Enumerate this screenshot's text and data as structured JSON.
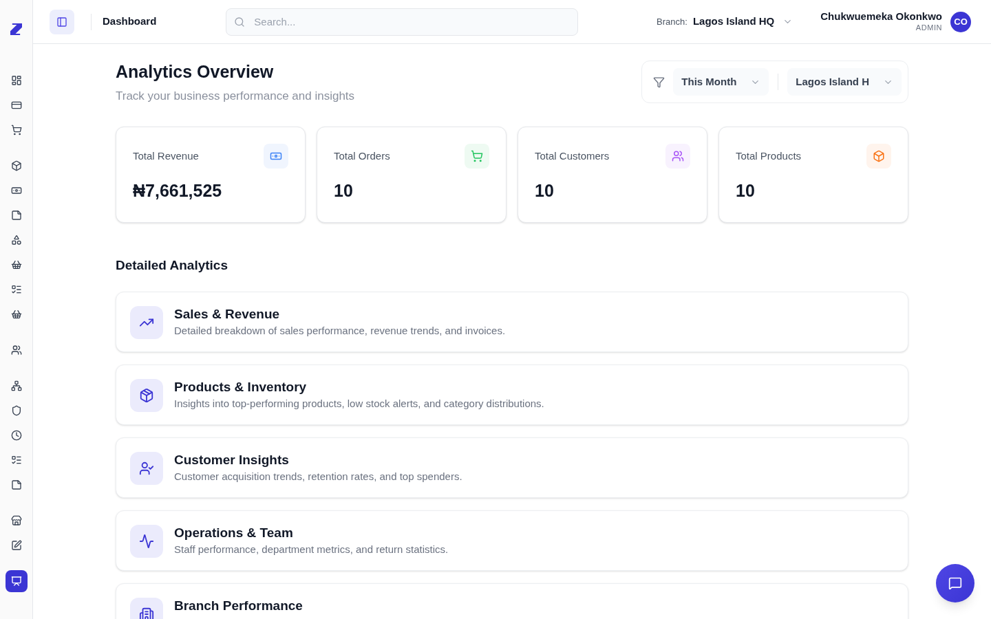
{
  "sidebar": {
    "groups": [
      {
        "items": [
          {
            "selected": false
          },
          {
            "selected": false
          },
          {
            "selected": false
          }
        ]
      },
      {
        "items": [
          {
            "selected": false
          },
          {
            "selected": false
          },
          {
            "selected": false
          },
          {
            "selected": false
          },
          {
            "selected": false
          },
          {
            "selected": false
          },
          {
            "selected": false
          }
        ]
      },
      {
        "items": [
          {
            "selected": false
          }
        ]
      },
      {
        "items": [
          {
            "selected": false
          },
          {
            "selected": false
          },
          {
            "selected": false
          },
          {
            "selected": false
          },
          {
            "selected": false
          }
        ]
      },
      {
        "items": [
          {
            "selected": false
          },
          {
            "selected": false
          }
        ]
      },
      {
        "items": [
          {
            "selected": true
          }
        ]
      }
    ]
  },
  "header": {
    "title": "Dashboard",
    "search": {
      "placeholder": "Search..."
    },
    "branch": {
      "label": "Branch:",
      "value": "Lagos Island HQ"
    },
    "user": {
      "name": "Chukwuemeka Okonkwo",
      "role": "ADMIN",
      "initials": "CO"
    }
  },
  "page": {
    "title": "Analytics Overview",
    "subtitle": "Track your business performance and insights"
  },
  "filters": [
    {
      "value": "This Month"
    },
    {
      "value": "Lagos Island H"
    }
  ],
  "stats": [
    {
      "label": "Total Revenue",
      "value": "₦7,661,525",
      "color": "#3b82f6"
    },
    {
      "label": "Total Orders",
      "value": "10",
      "color": "#22c55e"
    },
    {
      "label": "Total Customers",
      "value": "10",
      "color": "#a855f7"
    },
    {
      "label": "Total Products",
      "value": "10",
      "color": "#f97316"
    }
  ],
  "section_title": "Detailed Analytics",
  "analytics": [
    {
      "title": "Sales & Revenue",
      "description": "Detailed breakdown of sales performance, revenue trends, and invoices."
    },
    {
      "title": "Products & Inventory",
      "description": "Insights into top-performing products, low stock alerts, and category distributions."
    },
    {
      "title": "Customer Insights",
      "description": "Customer acquisition trends, retention rates, and top spenders."
    },
    {
      "title": "Operations & Team",
      "description": "Staff performance, department metrics, and return statistics."
    },
    {
      "title": "Branch Performance"
    }
  ]
}
